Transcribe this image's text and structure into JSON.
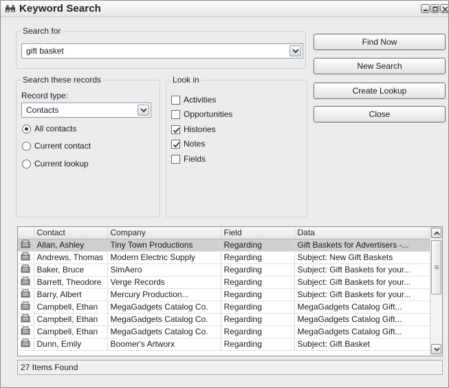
{
  "window": {
    "title": "Keyword Search",
    "icon": "binoculars-icon"
  },
  "search_for": {
    "legend": "Search for",
    "value": "gift basket"
  },
  "search_records": {
    "legend": "Search these records",
    "record_type_label": "Record type:",
    "record_type_value": "Contacts",
    "radios": [
      {
        "label": "All contacts",
        "checked": true
      },
      {
        "label": "Current contact",
        "checked": false
      },
      {
        "label": "Current lookup",
        "checked": false
      }
    ]
  },
  "look_in": {
    "legend": "Look in",
    "items": [
      {
        "label": "Activities",
        "checked": false
      },
      {
        "label": "Opportunities",
        "checked": false
      },
      {
        "label": "Histories",
        "checked": true
      },
      {
        "label": "Notes",
        "checked": true
      },
      {
        "label": "Fields",
        "checked": false
      }
    ]
  },
  "buttons": {
    "find_now": "Find Now",
    "new_search": "New Search",
    "create_lookup": "Create Lookup",
    "close": "Close"
  },
  "results": {
    "columns": [
      "Contact",
      "Company",
      "Field",
      "Data"
    ],
    "row_icon": "history-record-icon",
    "selected_row": 0,
    "rows": [
      [
        "Allan, Ashley",
        "Tiny Town Productions",
        "Regarding",
        "Gift Baskets for Advertisers -..."
      ],
      [
        "Andrews, Thomas",
        "Modern Electric Supply",
        "Regarding",
        "Subject: New Gift Baskets"
      ],
      [
        "Baker, Bruce",
        "SimAero",
        "Regarding",
        "Subject: Gift Baskets for your..."
      ],
      [
        "Barrett, Theodore",
        "Verge Records",
        "Regarding",
        "Subject: Gift Baskets for your..."
      ],
      [
        "Barry, Albert",
        "Mercury Production...",
        "Regarding",
        "Subject: Gift Baskets for your..."
      ],
      [
        "Campbell, Ethan",
        "MegaGadgets Catalog Co.",
        "Regarding",
        "MegaGadgets Catalog Gift..."
      ],
      [
        "Campbell, Ethan",
        "MegaGadgets Catalog Co.",
        "Regarding",
        "MegaGadgets Catalog Gift..."
      ],
      [
        "Campbell, Ethan",
        "MegaGadgets Catalog Co.",
        "Regarding",
        "MegaGadgets Catalog Gift..."
      ],
      [
        "Dunn, Emily",
        "Boomer's Artworx",
        "Regarding",
        "Subject: Gift Basket"
      ]
    ]
  },
  "status": {
    "text": "27 Items Found"
  }
}
